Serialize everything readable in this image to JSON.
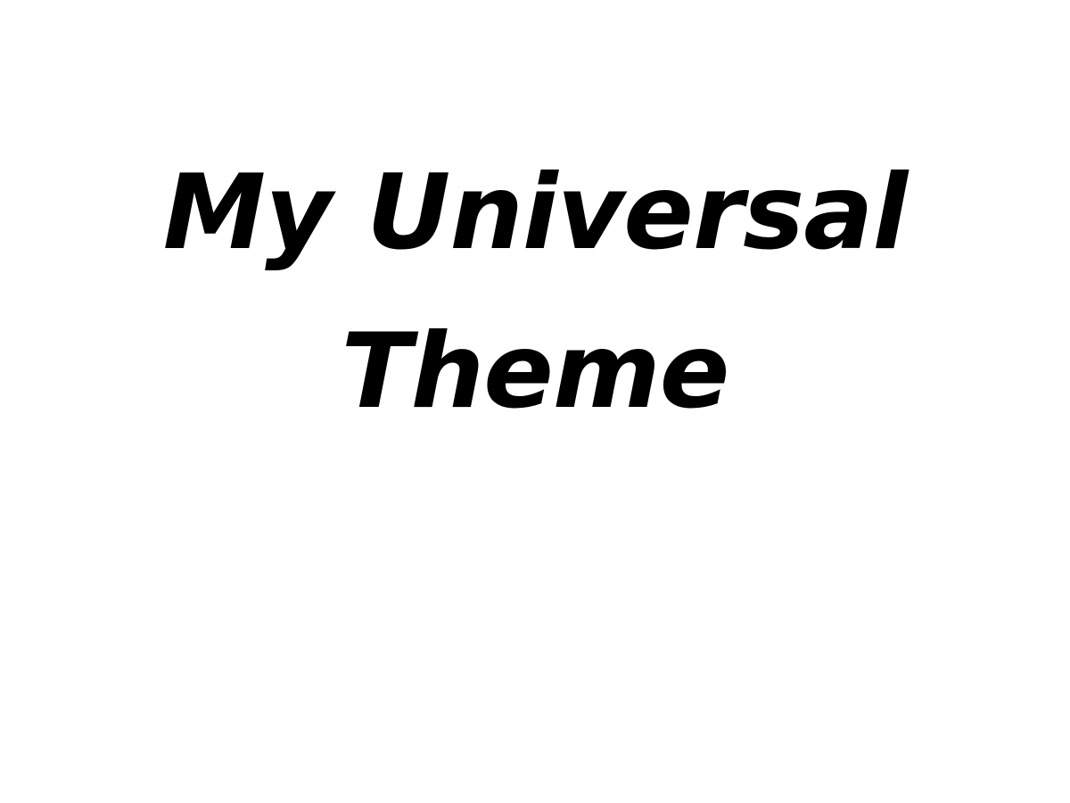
{
  "title": {
    "line1": "My Universal",
    "line2": "Theme"
  },
  "colors": {
    "background": "#ffffff",
    "text": "#000000"
  }
}
